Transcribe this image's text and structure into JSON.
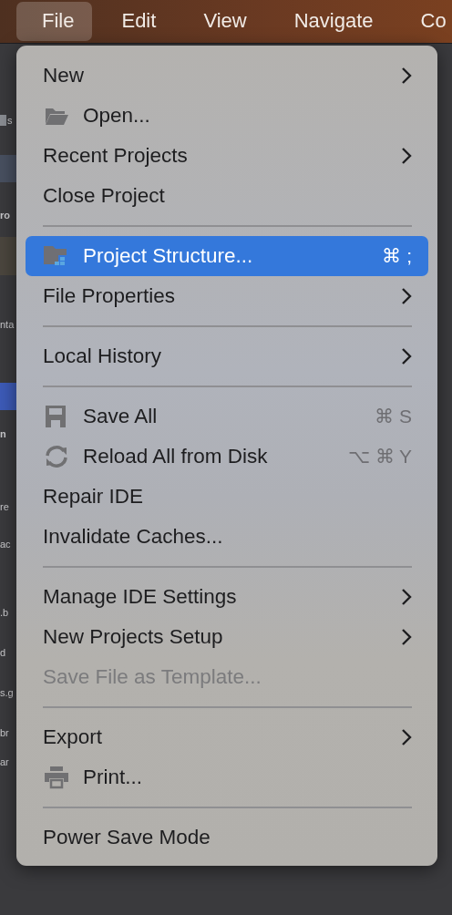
{
  "menubar": [
    {
      "label": "File",
      "selected": true
    },
    {
      "label": "Edit",
      "selected": false
    },
    {
      "label": "View",
      "selected": false
    },
    {
      "label": "Navigate",
      "selected": false
    },
    {
      "label": "Co",
      "selected": false
    }
  ],
  "background_fragments": [
    {
      "text": "s",
      "kind": "file"
    },
    {
      "text": "ro",
      "kind": "bold"
    },
    {
      "text": "nta",
      "kind": "plain"
    },
    {
      "text": "n",
      "kind": "bold"
    },
    {
      "text": "re",
      "kind": "plain"
    },
    {
      "text": "ac",
      "kind": "plain"
    },
    {
      "text": ".b",
      "kind": "plain"
    },
    {
      "text": "d",
      "kind": "plain"
    },
    {
      "text": "s.g",
      "kind": "plain"
    },
    {
      "text": "br",
      "kind": "plain"
    },
    {
      "text": "ar",
      "kind": "plain"
    }
  ],
  "menu": [
    {
      "kind": "item",
      "label": "New",
      "submenu": true,
      "selected": false,
      "disabled": false
    },
    {
      "kind": "item",
      "label": "Open...",
      "selected": false,
      "disabled": false
    },
    {
      "kind": "item",
      "label": "Recent Projects",
      "submenu": true,
      "selected": false,
      "disabled": false
    },
    {
      "kind": "item",
      "label": "Close Project",
      "selected": false,
      "disabled": false
    },
    {
      "kind": "separator"
    },
    {
      "kind": "item",
      "label": "Project Structure...",
      "shortcut": "⌘ ;",
      "selected": true,
      "disabled": false
    },
    {
      "kind": "item",
      "label": "File Properties",
      "submenu": true,
      "selected": false,
      "disabled": false
    },
    {
      "kind": "separator"
    },
    {
      "kind": "item",
      "label": "Local History",
      "submenu": true,
      "selected": false,
      "disabled": false
    },
    {
      "kind": "separator"
    },
    {
      "kind": "item",
      "label": "Save All",
      "shortcut": "⌘ S",
      "selected": false,
      "disabled": false
    },
    {
      "kind": "item",
      "label": "Reload All from Disk",
      "shortcut": "⌥ ⌘ Y",
      "selected": false,
      "disabled": false
    },
    {
      "kind": "item",
      "label": "Repair IDE",
      "selected": false,
      "disabled": false
    },
    {
      "kind": "item",
      "label": "Invalidate Caches...",
      "selected": false,
      "disabled": false
    },
    {
      "kind": "separator"
    },
    {
      "kind": "item",
      "label": "Manage IDE Settings",
      "submenu": true,
      "selected": false,
      "disabled": false
    },
    {
      "kind": "item",
      "label": "New Projects Setup",
      "submenu": true,
      "selected": false,
      "disabled": false
    },
    {
      "kind": "item",
      "label": "Save File as Template...",
      "selected": false,
      "disabled": true
    },
    {
      "kind": "separator"
    },
    {
      "kind": "item",
      "label": "Export",
      "submenu": true,
      "selected": false,
      "disabled": false
    },
    {
      "kind": "item",
      "label": "Print...",
      "selected": false,
      "disabled": false
    },
    {
      "kind": "separator"
    },
    {
      "kind": "item",
      "label": "Power Save Mode",
      "selected": false,
      "disabled": false
    }
  ]
}
